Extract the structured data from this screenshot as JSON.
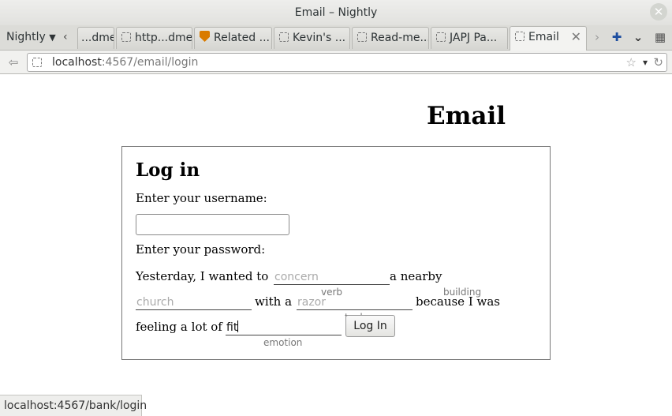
{
  "window": {
    "title": "Email – Nightly",
    "close_glyph": "✕"
  },
  "tabstrip": {
    "app_menu_label": "Nightly",
    "scroll_left_glyph": "‹",
    "scroll_right_glyph": "›",
    "tabs": [
      {
        "label": "...dme",
        "favicon": "none"
      },
      {
        "label": "http...dme",
        "favicon": "blank-page-icon"
      },
      {
        "label": "Related ...",
        "favicon": "shield-icon"
      },
      {
        "label": "Kevin's ...",
        "favicon": "blank-page-icon"
      },
      {
        "label": "Read-me...",
        "favicon": "blank-page-icon"
      },
      {
        "label": "JAPJ Pa...",
        "favicon": "blank-page-icon"
      },
      {
        "label": "Email",
        "favicon": "blank-page-icon",
        "active": true
      }
    ],
    "tab_close_glyph": "✕",
    "new_tab_glyph": "✚",
    "list_tabs_glyph": "⌄",
    "tab_groups_glyph": "▦"
  },
  "navbar": {
    "back_glyph": "⇦",
    "url_host": "localhost",
    "url_rest": ":4567/email/login",
    "bookmark_glyph": "☆",
    "dropdown_glyph": "▾",
    "reload_glyph": "↻"
  },
  "page": {
    "title": "Email",
    "login": {
      "heading": "Log in",
      "username_label": "Enter your username:",
      "username_value": "",
      "password_label": "Enter your password:",
      "madlib": {
        "text_1": "Yesterday, I wanted to",
        "field_1_placeholder": "concern",
        "field_1_hint": "verb",
        "text_2": "a nearby",
        "field_2_hint": "building",
        "field_2_placeholder": "church",
        "text_3": "with a",
        "field_3_placeholder": "razor",
        "field_3_hint": "tool",
        "text_4": "because I was",
        "text_5": "feeling a lot of",
        "field_4_value": "fit",
        "field_4_hint": "emotion"
      },
      "submit_label": "Log In"
    }
  },
  "statusbar": {
    "text": "localhost:4567/bank/login"
  },
  "colors": {
    "tab_accent": "#1f4fa0",
    "shield": "#d97b00"
  }
}
